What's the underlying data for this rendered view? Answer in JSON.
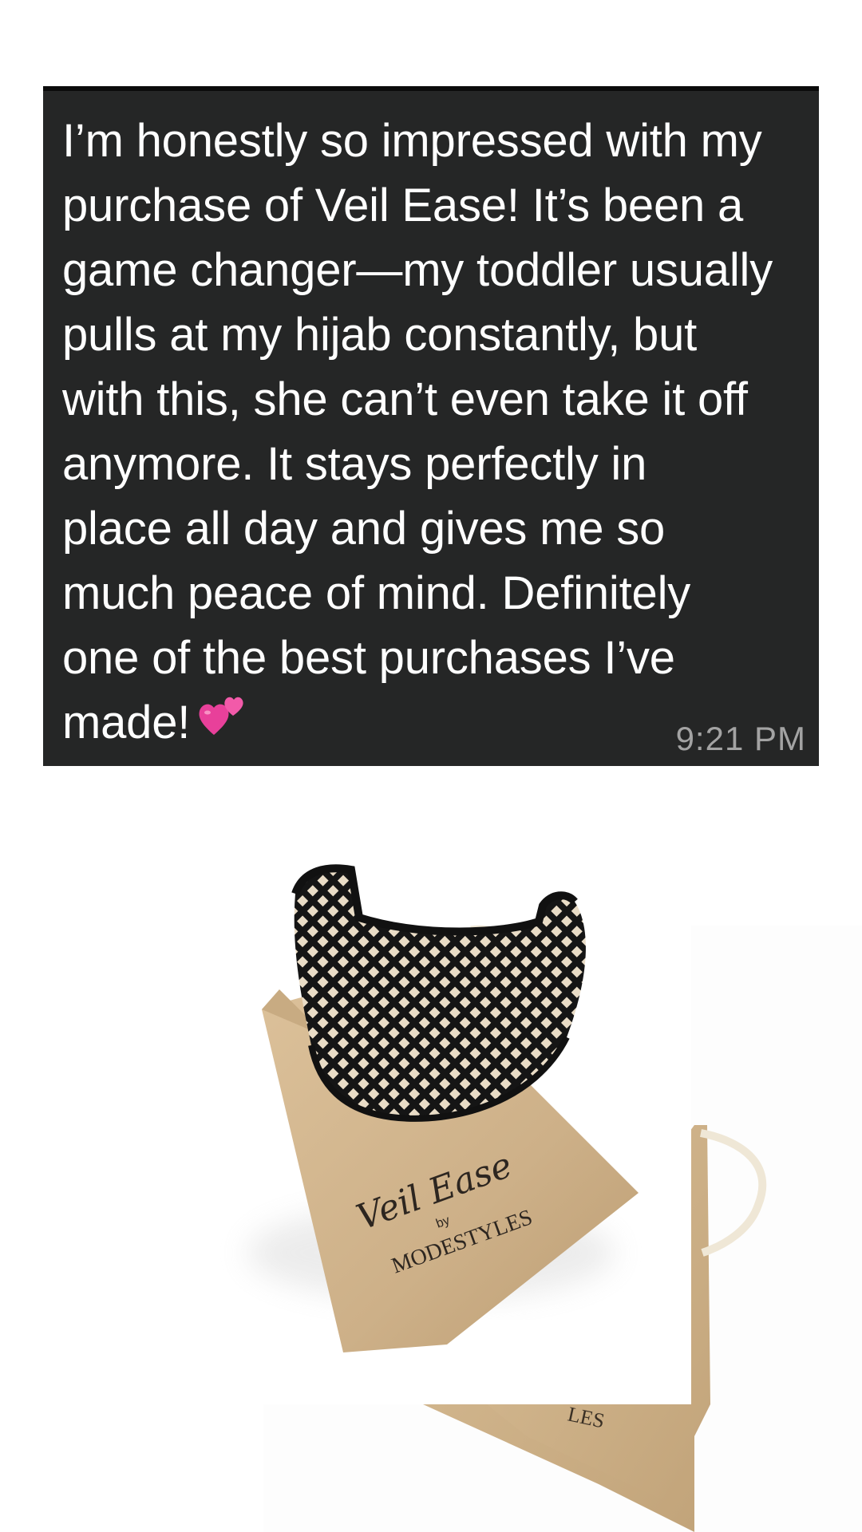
{
  "message": {
    "text": "I’m honestly so impressed with my\npurchase of Veil Ease! It’s been a\ngame changer—my toddler usually\npulls at my hijab constantly, but\nwith this, she can’t even take it off\nanymore. It stays perfectly in\nplace all day and gives me so\nmuch peace of mind. Definitely\none of the best purchases I’ve\nmade!",
    "emoji_icon": "two-hearts-icon",
    "timestamp": "9:21 PM",
    "bubble_color": "#252626",
    "text_color": "#ffffff",
    "timestamp_color": "#a3a3a3"
  },
  "product_photo": {
    "brand_script": "Veil Ease",
    "by_label": "by",
    "maker": "MODESTYLES",
    "partial_maker": "LES",
    "pouch_color": "#cfb28a",
    "band_color": "#151515"
  }
}
